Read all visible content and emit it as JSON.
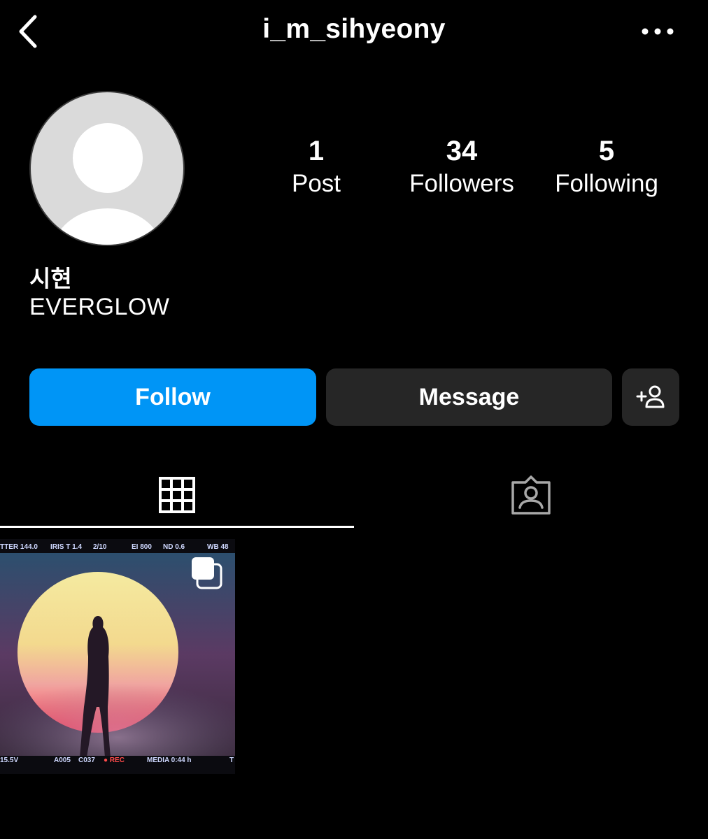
{
  "header": {
    "username": "i_m_sihyeony",
    "back_icon": "chevron-left-icon",
    "more_icon": "more-horizontal-icon"
  },
  "profile": {
    "avatar_icon": "default-avatar-icon",
    "full_name": "시현",
    "bio": "EVERGLOW"
  },
  "stats": [
    {
      "value": "1",
      "label": "Post"
    },
    {
      "value": "34",
      "label": "Followers"
    },
    {
      "value": "5",
      "label": "Following"
    }
  ],
  "actions": {
    "follow_label": "Follow",
    "message_label": "Message",
    "add_user_icon": "add-user-icon"
  },
  "tabs": [
    {
      "icon": "grid-icon",
      "active": true
    },
    {
      "icon": "tagged-icon",
      "active": false
    }
  ],
  "posts": [
    {
      "type": "carousel",
      "overlay": {
        "top": [
          "TTER 144.0",
          "IRIS T 1.4",
          "2/10",
          "EI 800",
          "ND 0.6",
          "WB 48"
        ],
        "bottom": [
          "15.5V",
          "A005",
          "C037",
          "● REC",
          "MEDIA 0:44 h",
          "T"
        ]
      }
    }
  ],
  "colors": {
    "background": "#000000",
    "follow_button": "#0095f6",
    "secondary_button": "#262626",
    "avatar_placeholder": "#dadada"
  }
}
